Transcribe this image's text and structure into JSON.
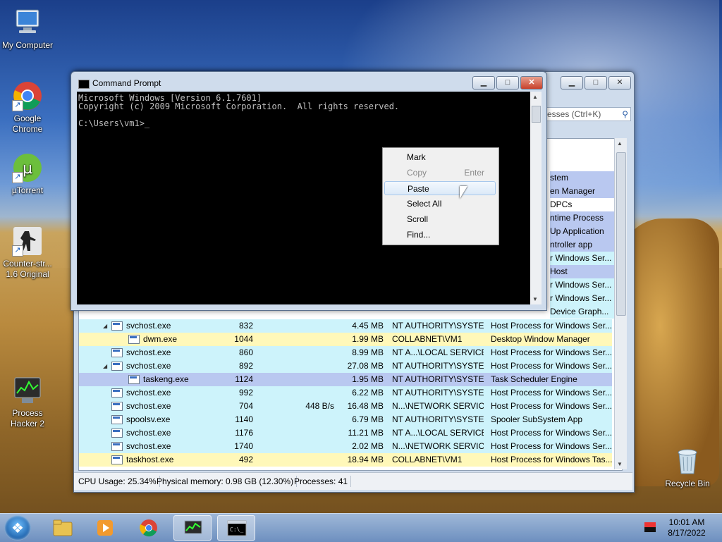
{
  "desktop": {
    "icons": [
      {
        "label": "My Computer"
      },
      {
        "label": "Google Chrome"
      },
      {
        "label": "µTorrent"
      },
      {
        "label": "Counter-str... 1.6 Original"
      },
      {
        "label": "Process Hacker 2"
      },
      {
        "label": "Recycle Bin"
      }
    ]
  },
  "process_hacker": {
    "search_placeholder": "esses (Ctrl+K)",
    "peek_rows": [
      "stem",
      "en Manager",
      "DPCs",
      "ntime Process",
      "Up Application",
      "ntroller app",
      "r Windows Ser...",
      "Host",
      "r Windows Ser...",
      "r Windows Ser...",
      "Device Graph..."
    ],
    "rows": [
      {
        "indent": 2,
        "expand": true,
        "name": "svchost.exe",
        "pid": "832",
        "io": "",
        "mem": "4.45 MB",
        "user": "NT AUTHORITY\\SYSTEM",
        "desc": "Host Process for Windows Ser...",
        "color": "#cdf3fb"
      },
      {
        "indent": 3,
        "expand": false,
        "name": "dwm.exe",
        "pid": "1044",
        "io": "",
        "mem": "1.99 MB",
        "user": "COLLABNET\\VM1",
        "desc": "Desktop Window Manager",
        "color": "#fff8b9"
      },
      {
        "indent": 2,
        "expand": false,
        "name": "svchost.exe",
        "pid": "860",
        "io": "",
        "mem": "8.99 MB",
        "user": "NT A...\\LOCAL SERVICE",
        "desc": "Host Process for Windows Ser...",
        "color": "#cdf3fb"
      },
      {
        "indent": 2,
        "expand": true,
        "name": "svchost.exe",
        "pid": "892",
        "io": "",
        "mem": "27.08 MB",
        "user": "NT AUTHORITY\\SYSTEM",
        "desc": "Host Process for Windows Ser...",
        "color": "#cdf3fb"
      },
      {
        "indent": 3,
        "expand": false,
        "name": "taskeng.exe",
        "pid": "1124",
        "io": "",
        "mem": "1.95 MB",
        "user": "NT AUTHORITY\\SYSTEM",
        "desc": "Task Scheduler Engine",
        "color": "#b9c8f0"
      },
      {
        "indent": 2,
        "expand": false,
        "name": "svchost.exe",
        "pid": "992",
        "io": "",
        "mem": "6.22 MB",
        "user": "NT AUTHORITY\\SYSTEM",
        "desc": "Host Process for Windows Ser...",
        "color": "#cdf3fb"
      },
      {
        "indent": 2,
        "expand": false,
        "name": "svchost.exe",
        "pid": "704",
        "io": "448 B/s",
        "mem": "16.48 MB",
        "user": "N...\\NETWORK SERVICE",
        "desc": "Host Process for Windows Ser...",
        "color": "#cdf3fb"
      },
      {
        "indent": 2,
        "expand": false,
        "name": "spoolsv.exe",
        "pid": "1140",
        "io": "",
        "mem": "6.79 MB",
        "user": "NT AUTHORITY\\SYSTEM",
        "desc": "Spooler SubSystem App",
        "color": "#cdf3fb"
      },
      {
        "indent": 2,
        "expand": false,
        "name": "svchost.exe",
        "pid": "1176",
        "io": "",
        "mem": "11.21 MB",
        "user": "NT A...\\LOCAL SERVICE",
        "desc": "Host Process for Windows Ser...",
        "color": "#cdf3fb"
      },
      {
        "indent": 2,
        "expand": false,
        "name": "svchost.exe",
        "pid": "1740",
        "io": "",
        "mem": "2.02 MB",
        "user": "N...\\NETWORK SERVICE",
        "desc": "Host Process for Windows Ser...",
        "color": "#cdf3fb"
      },
      {
        "indent": 2,
        "expand": false,
        "name": "taskhost.exe",
        "pid": "492",
        "io": "",
        "mem": "18.94 MB",
        "user": "COLLABNET\\VM1",
        "desc": "Host Process for Windows Tas...",
        "color": "#fff8b9"
      }
    ],
    "status": {
      "cpu": "CPU Usage: 25.34%",
      "memory": "Physical memory: 0.98 GB (12.30%)",
      "processes": "Processes: 41"
    }
  },
  "cmd": {
    "title": "Command Prompt",
    "line1": "Microsoft Windows [Version 6.1.7601]",
    "line2": "Copyright (c) 2009 Microsoft Corporation.  All rights reserved.",
    "prompt": "C:\\Users\\vm1>_"
  },
  "context_menu": {
    "items": [
      {
        "label": "Mark",
        "shortcut": "",
        "disabled": false
      },
      {
        "label": "Copy",
        "shortcut": "Enter",
        "disabled": true
      },
      {
        "label": "Paste",
        "shortcut": "",
        "disabled": false
      },
      {
        "label": "Select All",
        "shortcut": "",
        "disabled": false
      },
      {
        "label": "Scroll",
        "shortcut": "",
        "disabled": false
      },
      {
        "label": "Find...",
        "shortcut": "",
        "disabled": false
      }
    ]
  },
  "taskbar": {
    "time": "10:01 AM",
    "date": "8/17/2022"
  }
}
